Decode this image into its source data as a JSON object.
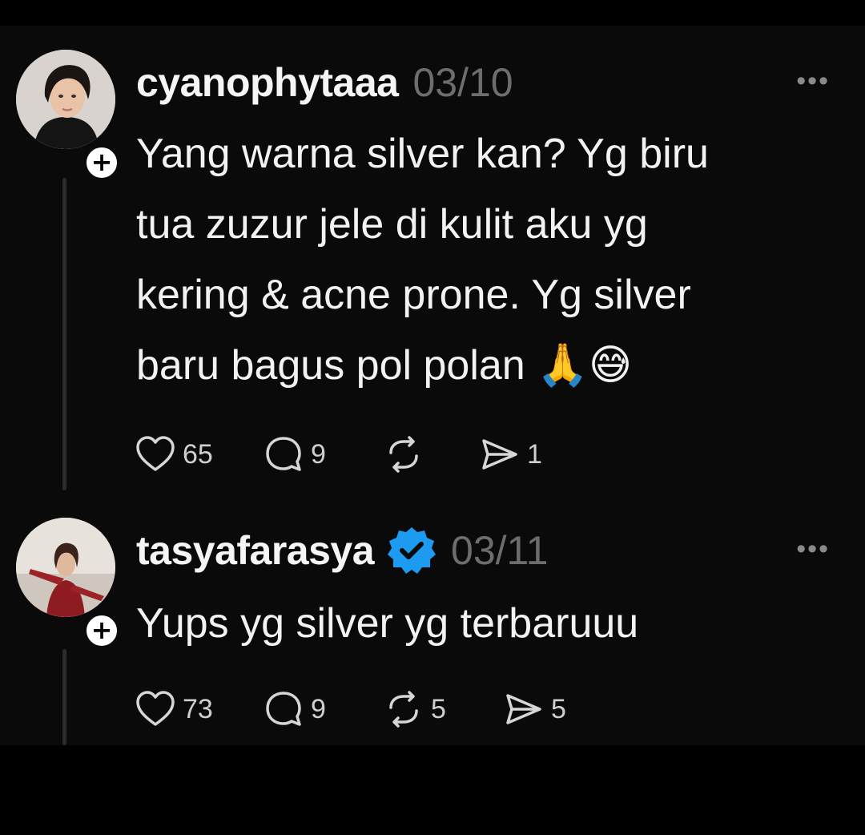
{
  "comments": [
    {
      "username": "cyanophytaaa",
      "date": "03/10",
      "verified": false,
      "text_lines": [
        "Yang warna silver kan? Yg biru",
        "tua zuzur jele di kulit aku yg",
        "kering & acne prone. Yg silver",
        "baru bagus pol polan 🙏😅"
      ],
      "follow_symbol": "+",
      "more_symbol": "•••",
      "likes": "65",
      "replies": "9",
      "reposts": "",
      "shares": "1"
    },
    {
      "username": "tasyafarasya",
      "date": "03/11",
      "verified": true,
      "text_lines": [
        "Yups yg silver yg terbaruuu"
      ],
      "follow_symbol": "+",
      "more_symbol": "•••",
      "likes": "73",
      "replies": "9",
      "reposts": "5",
      "shares": "5"
    }
  ],
  "icons": {
    "like": "heart-icon",
    "reply": "comment-bubble-icon",
    "repost": "repost-icon",
    "share": "send-icon",
    "verified": "verified-badge-icon",
    "more": "more-options-icon",
    "follow": "follow-plus-icon"
  },
  "colors": {
    "background": "#0a0a0a",
    "text": "#f2f2f2",
    "muted": "#6d6d6d",
    "verified_blue": "#1d9bf0"
  }
}
